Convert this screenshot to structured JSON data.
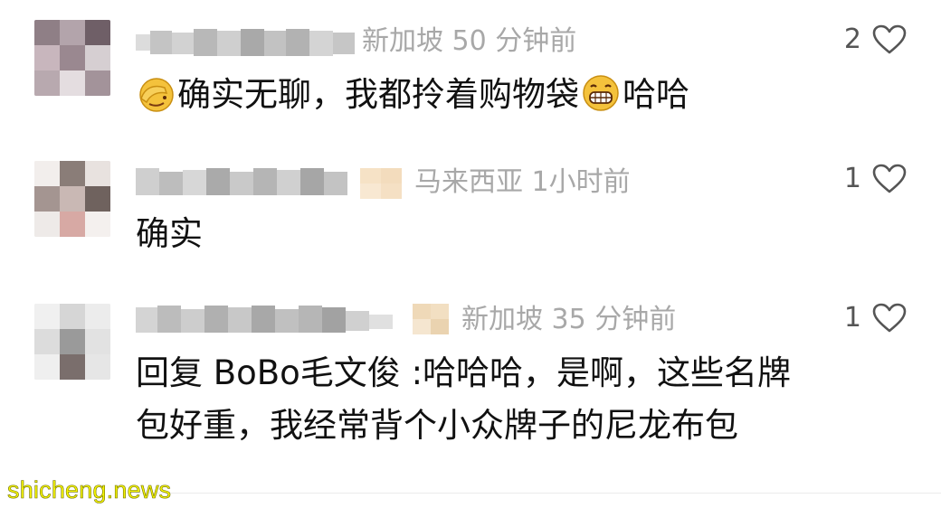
{
  "comments": [
    {
      "location": "新加坡",
      "time": "50 分钟前",
      "likes": "2",
      "text_parts": [
        "确实无聊，我都拎着购物袋",
        "哈哈"
      ],
      "emojis": [
        "facepalm-emoji",
        "grin-emoji"
      ]
    },
    {
      "location": "马来西亚",
      "time": "1小时前",
      "likes": "1",
      "text": "确实"
    },
    {
      "location": "新加坡",
      "time": "35 分钟前",
      "likes": "1",
      "reply_prefix": "回复 BoBo毛文俊 :",
      "text_line1": "哈哈哈，是啊，这些名牌",
      "text_line2": "包好重，我经常背个小众牌子的尼龙布包"
    }
  ],
  "watermark": "shicheng.news",
  "colors": {
    "meta_text": "#a8a8a8",
    "body_text": "#111111",
    "watermark_fill": "#f5f500"
  },
  "icons": [
    "heart-outline-icon",
    "facepalm-emoji",
    "grin-emoji"
  ]
}
